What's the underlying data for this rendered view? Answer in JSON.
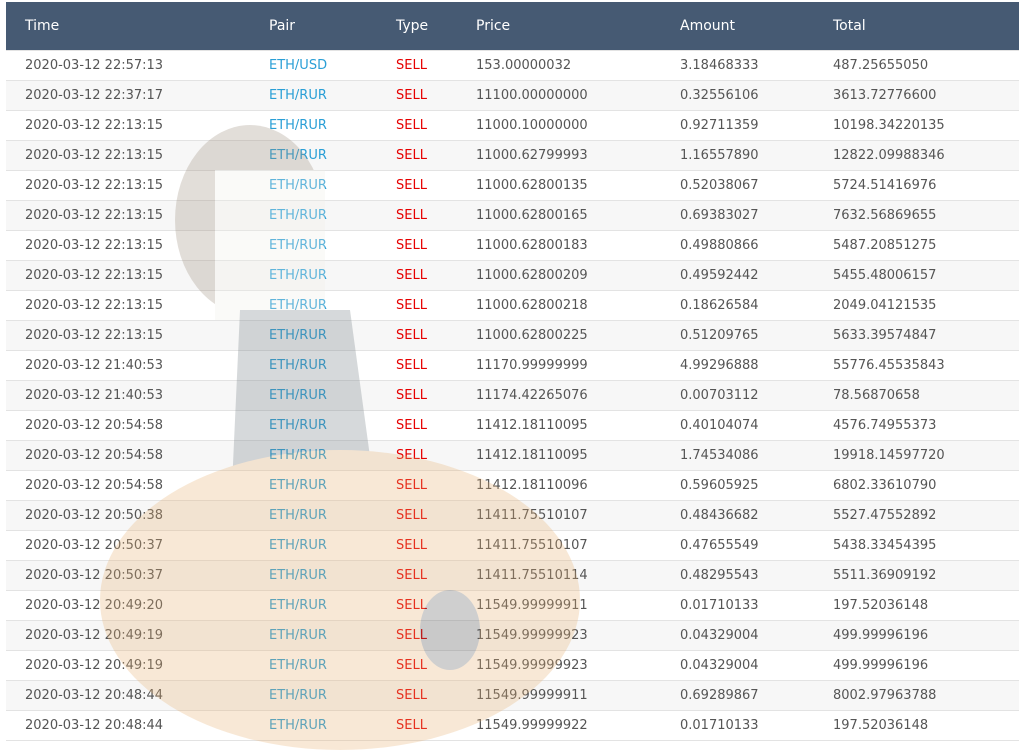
{
  "table": {
    "columns": [
      "Time",
      "Pair",
      "Type",
      "Price",
      "Amount",
      "Total"
    ],
    "rows": [
      [
        "2020-03-12 22:57:13",
        "ETH/USD",
        "SELL",
        "153.00000032",
        "3.18468333",
        "487.25655050"
      ],
      [
        "2020-03-12 22:37:17",
        "ETH/RUR",
        "SELL",
        "11100.00000000",
        "0.32556106",
        "3613.72776600"
      ],
      [
        "2020-03-12 22:13:15",
        "ETH/RUR",
        "SELL",
        "11000.10000000",
        "0.92711359",
        "10198.34220135"
      ],
      [
        "2020-03-12 22:13:15",
        "ETH/RUR",
        "SELL",
        "11000.62799993",
        "1.16557890",
        "12822.09988346"
      ],
      [
        "2020-03-12 22:13:15",
        "ETH/RUR",
        "SELL",
        "11000.62800135",
        "0.52038067",
        "5724.51416976"
      ],
      [
        "2020-03-12 22:13:15",
        "ETH/RUR",
        "SELL",
        "11000.62800165",
        "0.69383027",
        "7632.56869655"
      ],
      [
        "2020-03-12 22:13:15",
        "ETH/RUR",
        "SELL",
        "11000.62800183",
        "0.49880866",
        "5487.20851275"
      ],
      [
        "2020-03-12 22:13:15",
        "ETH/RUR",
        "SELL",
        "11000.62800209",
        "0.49592442",
        "5455.48006157"
      ],
      [
        "2020-03-12 22:13:15",
        "ETH/RUR",
        "SELL",
        "11000.62800218",
        "0.18626584",
        "2049.04121535"
      ],
      [
        "2020-03-12 22:13:15",
        "ETH/RUR",
        "SELL",
        "11000.62800225",
        "0.51209765",
        "5633.39574847"
      ],
      [
        "2020-03-12 21:40:53",
        "ETH/RUR",
        "SELL",
        "11170.99999999",
        "4.99296888",
        "55776.45535843"
      ],
      [
        "2020-03-12 21:40:53",
        "ETH/RUR",
        "SELL",
        "11174.42265076",
        "0.00703112",
        "78.56870658"
      ],
      [
        "2020-03-12 20:54:58",
        "ETH/RUR",
        "SELL",
        "11412.18110095",
        "0.40104074",
        "4576.74955373"
      ],
      [
        "2020-03-12 20:54:58",
        "ETH/RUR",
        "SELL",
        "11412.18110095",
        "1.74534086",
        "19918.14597720"
      ],
      [
        "2020-03-12 20:54:58",
        "ETH/RUR",
        "SELL",
        "11412.18110096",
        "0.59605925",
        "6802.33610790"
      ],
      [
        "2020-03-12 20:50:38",
        "ETH/RUR",
        "SELL",
        "11411.75510107",
        "0.48436682",
        "5527.47552892"
      ],
      [
        "2020-03-12 20:50:37",
        "ETH/RUR",
        "SELL",
        "11411.75510107",
        "0.47655549",
        "5438.33454395"
      ],
      [
        "2020-03-12 20:50:37",
        "ETH/RUR",
        "SELL",
        "11411.75510114",
        "0.48295543",
        "5511.36909192"
      ],
      [
        "2020-03-12 20:49:20",
        "ETH/RUR",
        "SELL",
        "11549.99999911",
        "0.01710133",
        "197.52036148"
      ],
      [
        "2020-03-12 20:49:19",
        "ETH/RUR",
        "SELL",
        "11549.99999923",
        "0.04329004",
        "499.99996196"
      ],
      [
        "2020-03-12 20:49:19",
        "ETH/RUR",
        "SELL",
        "11549.99999923",
        "0.04329004",
        "499.99996196"
      ],
      [
        "2020-03-12 20:48:44",
        "ETH/RUR",
        "SELL",
        "11549.99999911",
        "0.69289867",
        "8002.97963788"
      ],
      [
        "2020-03-12 20:48:44",
        "ETH/RUR",
        "SELL",
        "11549.99999922",
        "0.01710133",
        "197.52036148"
      ]
    ]
  },
  "colors": {
    "header_bg": "#465a73",
    "pair": "#2a9fd6",
    "sell": "#e60000",
    "alt_row": "#f7f7f7"
  }
}
